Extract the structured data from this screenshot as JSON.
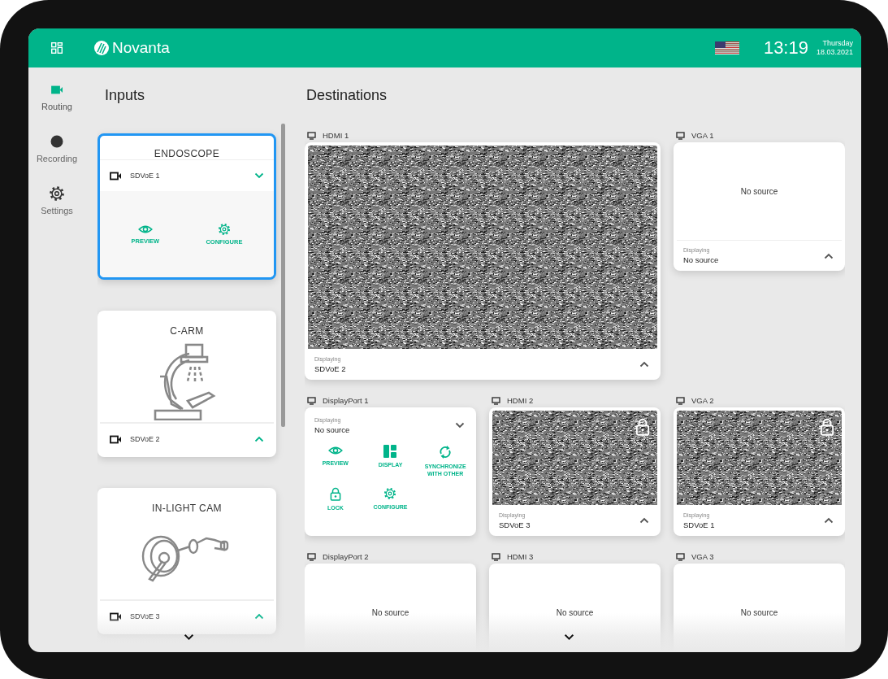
{
  "header": {
    "logo": "Novanta",
    "time": "13:19",
    "day": "Thursday",
    "date": "18.03.2021"
  },
  "nav": [
    {
      "label": "Routing",
      "kind": "routing",
      "selected": true
    },
    {
      "label": "Recording",
      "kind": "recording",
      "selected": false
    },
    {
      "label": "Settings",
      "kind": "settings",
      "selected": false
    }
  ],
  "inputs": {
    "title": "Inputs",
    "cards": [
      {
        "name": "ENDOSCOPE",
        "source": "SDVoE 1",
        "selected": true,
        "expanded": true,
        "kind": "endoscope",
        "actions": [
          {
            "label": "PREVIEW",
            "kind": "preview"
          },
          {
            "label": "CONFIGURE",
            "kind": "configure"
          }
        ]
      },
      {
        "name": "C-ARM",
        "source": "SDVoE 2",
        "selected": false,
        "expanded": false,
        "kind": "c-arm"
      },
      {
        "name": "IN-LIGHT CAM",
        "source": "SDVoE 3",
        "selected": false,
        "expanded": false,
        "kind": "surgical-light"
      }
    ]
  },
  "destinations": {
    "title": "Destinations",
    "outputs": [
      {
        "label": "HDMI 1",
        "kind": "video",
        "wide": true,
        "locked": false,
        "displaying_label": "Displaying",
        "displaying": "SDVoE 2",
        "expanded": false
      },
      {
        "label": "VGA 1",
        "kind": "empty",
        "wide": false,
        "locked": false,
        "placeholder": "No source",
        "displaying_label": "Displaying",
        "displaying": "No source",
        "expanded": false
      },
      {
        "label": "DisplayPort 1",
        "kind": "menu",
        "wide": false,
        "locked": false,
        "displaying_label": "Displaying",
        "displaying": "No source",
        "expanded": true,
        "actions": [
          {
            "label": "PREVIEW",
            "kind": "preview"
          },
          {
            "label": "DISPLAY",
            "kind": "display"
          },
          {
            "label": "SYNCHRONIZE WITH OTHER",
            "kind": "sync"
          },
          {
            "label": "LOCK",
            "kind": "lock"
          },
          {
            "label": "CONFIGURE",
            "kind": "configure"
          }
        ]
      },
      {
        "label": "HDMI 2",
        "kind": "video",
        "wide": false,
        "locked": true,
        "displaying_label": "Displaying",
        "displaying": "SDVoE 3",
        "expanded": false
      },
      {
        "label": "VGA 2",
        "kind": "video",
        "wide": false,
        "locked": true,
        "displaying_label": "Displaying",
        "displaying": "SDVoE 1",
        "expanded": false
      },
      {
        "label": "DisplayPort 2",
        "kind": "empty",
        "wide": false,
        "locked": false,
        "placeholder": "No source"
      },
      {
        "label": "HDMI 3",
        "kind": "empty",
        "wide": false,
        "locked": false,
        "placeholder": "No source"
      },
      {
        "label": "VGA 3",
        "kind": "empty",
        "wide": false,
        "locked": false,
        "placeholder": "No source"
      }
    ]
  }
}
